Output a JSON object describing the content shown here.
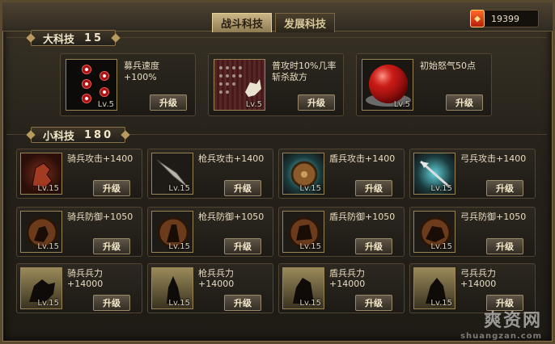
{
  "tabs": [
    {
      "label": "战斗科技",
      "active": true
    },
    {
      "label": "发展科技",
      "active": false
    }
  ],
  "currency": {
    "icon": "red-token-icon",
    "amount": "19399"
  },
  "big_section": {
    "title": "大科技",
    "count": "15"
  },
  "small_section": {
    "title": "小科技",
    "count": "180"
  },
  "big_techs": [
    {
      "icon": "recruit-dots-icon",
      "desc": "募兵速度\n+100%",
      "level": "Lv.5",
      "button": "升级"
    },
    {
      "icon": "cavalry-charge-icon",
      "desc": "普攻时10%几率斩杀敌方",
      "level": "Lv.5",
      "button": "升级"
    },
    {
      "icon": "red-orb-icon",
      "desc": "初始怒气50点",
      "level": "Lv.5",
      "button": "升级"
    }
  ],
  "small_techs": [
    {
      "icon": "cavalry-horse-icon",
      "desc": "骑兵攻击+1400",
      "level": "Lv.15",
      "button": "升级"
    },
    {
      "icon": "spear-icon",
      "desc": "枪兵攻击+1400",
      "level": "Lv.15",
      "button": "升级"
    },
    {
      "icon": "shield-icon",
      "desc": "盾兵攻击+1400",
      "level": "Lv.15",
      "button": "升级"
    },
    {
      "icon": "arrow-icon",
      "desc": "弓兵攻击+1400",
      "level": "Lv.15",
      "button": "升级"
    },
    {
      "icon": "cavalry-defense-icon",
      "desc": "骑兵防御+1050",
      "level": "Lv.15",
      "button": "升级"
    },
    {
      "icon": "spear-defense-icon",
      "desc": "枪兵防御+1050",
      "level": "Lv.15",
      "button": "升级"
    },
    {
      "icon": "shield-defense-icon",
      "desc": "盾兵防御+1050",
      "level": "Lv.15",
      "button": "升级"
    },
    {
      "icon": "archer-defense-icon",
      "desc": "弓兵防御+1050",
      "level": "Lv.15",
      "button": "升级"
    },
    {
      "icon": "cavalry-troops-icon",
      "desc": "骑兵兵力\n+14000",
      "level": "Lv.15",
      "button": "升级"
    },
    {
      "icon": "spear-troops-icon",
      "desc": "枪兵兵力\n+14000",
      "level": "Lv.15",
      "button": "升级"
    },
    {
      "icon": "shield-troops-icon",
      "desc": "盾兵兵力\n+14000",
      "level": "Lv.15",
      "button": "升级"
    },
    {
      "icon": "archer-troops-icon",
      "desc": "弓兵兵力\n+14000",
      "level": "Lv.15",
      "button": "升级"
    }
  ],
  "watermark": {
    "main": "爽资网",
    "sub": "shuangzan.com"
  },
  "colors": {
    "frame_gold": "#8a7248",
    "button_border": "#9b8a6a",
    "active_tab": "#c9b585"
  }
}
